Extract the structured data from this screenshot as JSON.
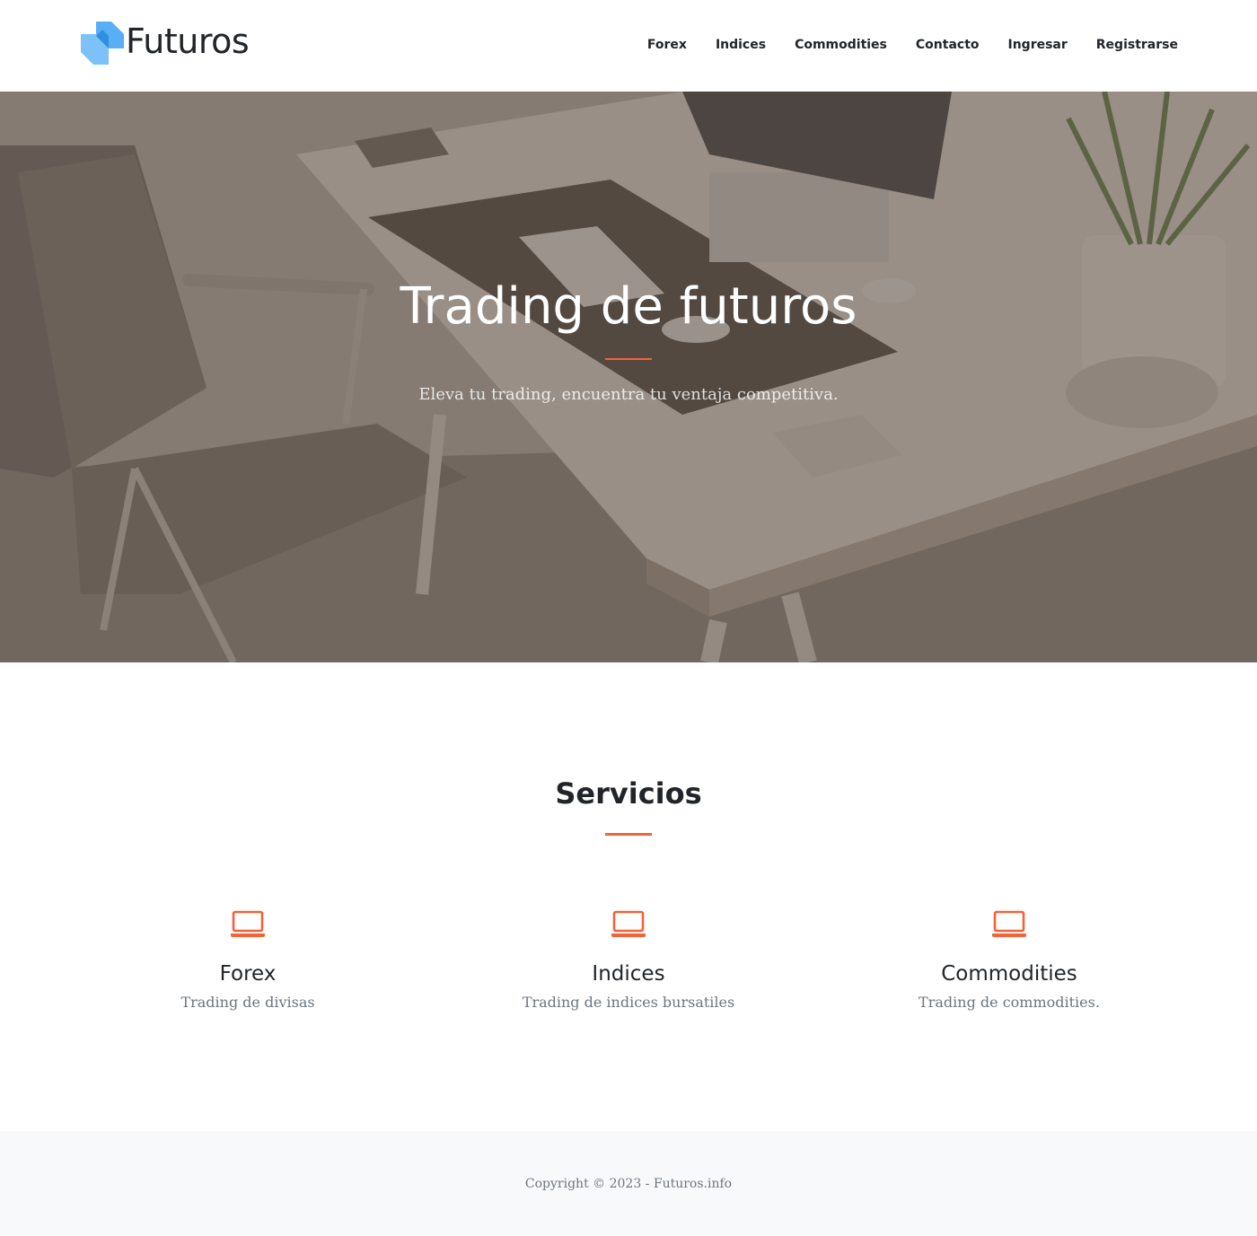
{
  "brand": {
    "name": "Futuros",
    "logo_icon": "cube-logo-icon"
  },
  "nav": {
    "items": [
      {
        "label": "Forex"
      },
      {
        "label": "Indices"
      },
      {
        "label": "Commodities"
      },
      {
        "label": "Contacto"
      },
      {
        "label": "Ingresar"
      },
      {
        "label": "Registrarse"
      }
    ]
  },
  "hero": {
    "title": "Trading de futuros",
    "subtitle": "Eleva tu trading, encuentra tu ventaja competitiva."
  },
  "services": {
    "title": "Servicios",
    "items": [
      {
        "icon": "laptop-icon",
        "title": "Forex",
        "description": "Trading de divisas"
      },
      {
        "icon": "laptop-icon",
        "title": "Indices",
        "description": "Trading de indices bursatiles"
      },
      {
        "icon": "laptop-icon",
        "title": "Commodities",
        "description": "Trading de commodities."
      }
    ]
  },
  "footer": {
    "copyright": "Copyright © 2023 - Futuros.info"
  },
  "colors": {
    "accent": "#f4623a",
    "logo": "#5aaef5",
    "text": "#212529",
    "muted": "#6c757d"
  }
}
